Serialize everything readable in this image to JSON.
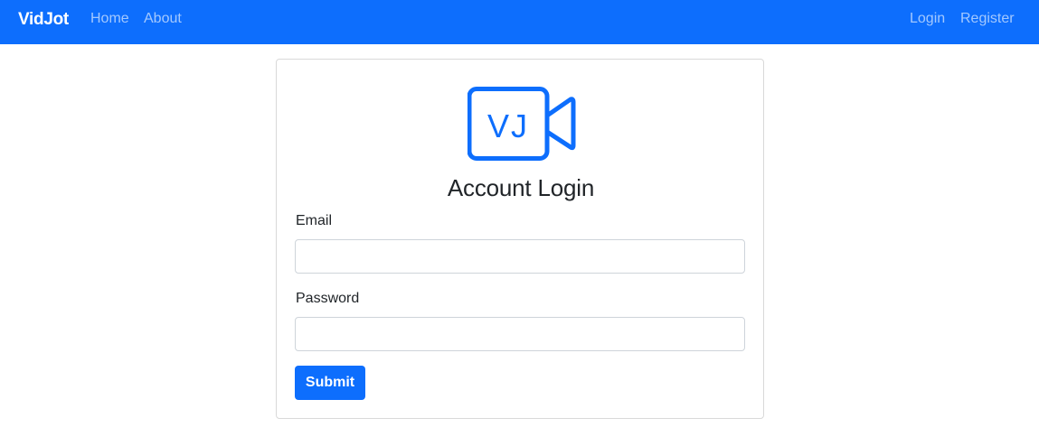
{
  "navbar": {
    "brand": "VidJot",
    "left_links": [
      "Home",
      "About"
    ],
    "right_links": [
      "Login",
      "Register"
    ]
  },
  "logo": {
    "text": "VJ",
    "icon": "video-camera-icon"
  },
  "login_form": {
    "title": "Account Login",
    "email_label": "Email",
    "email_value": "",
    "password_label": "Password",
    "password_value": "",
    "submit_label": "Submit"
  },
  "colors": {
    "primary": "#0d6efd",
    "nav_text": "#ffffff",
    "text": "#212529",
    "border": "#ced4da"
  }
}
